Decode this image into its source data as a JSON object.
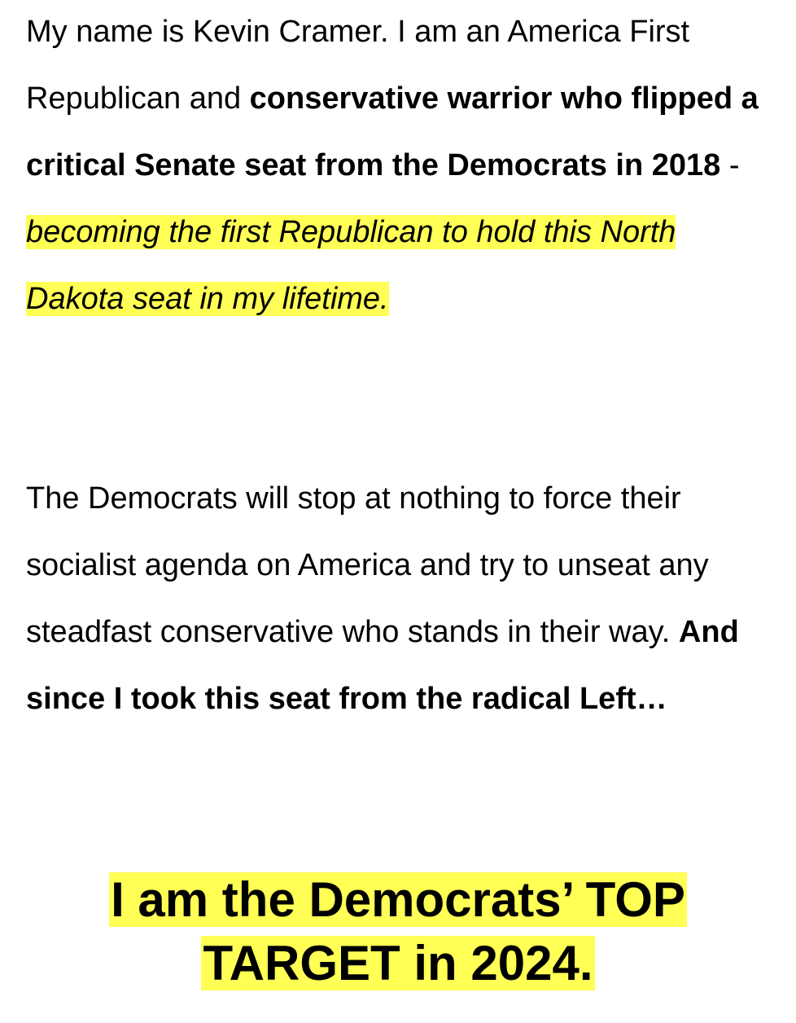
{
  "paragraph1": {
    "intro": "My name is Kevin Cramer. I am an America First Republican and ",
    "bold_claim": "conservative warrior who flipped a critical Senate seat from the Democrats in 2018",
    "dash": " - ",
    "highlighted": "becoming the first Republican to hold this North Dakota seat in my lifetime. "
  },
  "paragraph2": {
    "text": "The Democrats will stop at nothing to force their socialist agenda on America and try to unseat any steadfast conservative who stands in their way. ",
    "bold_text": "And since I took this seat from the radical Left…"
  },
  "headline": {
    "line1": "I am the Democrats’ TOP",
    "line2": "TARGET in 2024."
  },
  "colors": {
    "highlight": "#ffff55",
    "text": "#000000",
    "background": "#ffffff"
  }
}
